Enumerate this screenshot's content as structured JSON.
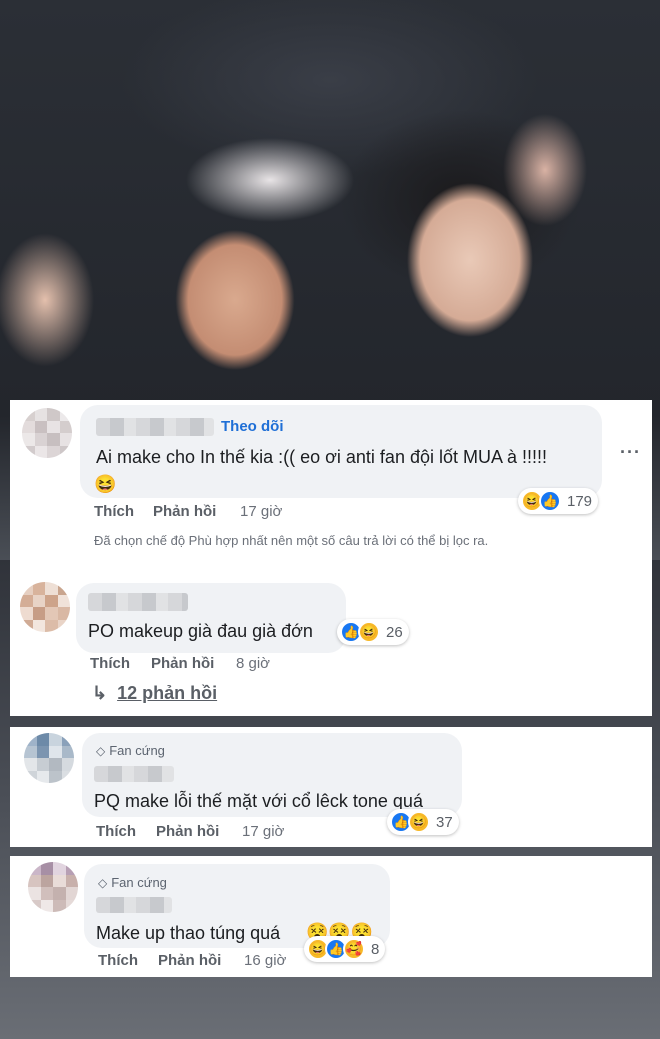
{
  "colors": {
    "link_blue": "#1f6fd6",
    "bubble_bg": "#f0f2f5",
    "secondary_text": "#5a5f66",
    "like_blue": "#1877f2",
    "haha_yellow": "#f7b928"
  },
  "comments": [
    {
      "follow_label": "Theo dõi",
      "text": "Ai make cho In thế kia :(( eo ơi anti fan đội lốt MUA à !!!!!",
      "trailing_emoji": "😆",
      "like_label": "Thích",
      "reply_label": "Phản hồi",
      "time": "17 giờ",
      "reaction_count": "179",
      "reactions": [
        "haha-icon",
        "like-icon"
      ],
      "filter_note": "Đã chọn chế độ Phù hợp nhất nên một số câu trả lời có thể bị lọc ra."
    },
    {
      "text": "PO makeup già đau già đớn",
      "like_label": "Thích",
      "reply_label": "Phản hồi",
      "time": "8 giờ",
      "reaction_count": "26",
      "reactions": [
        "like-icon",
        "haha-icon"
      ],
      "replies_label": "12 phản hồi"
    },
    {
      "badge": "Fan cứng",
      "text": "PQ make lỗi thế mặt với cổ lêck tone quá",
      "like_label": "Thích",
      "reply_label": "Phản hồi",
      "time": "17 giờ",
      "reaction_count": "37",
      "reactions": [
        "like-icon",
        "haha-icon"
      ]
    },
    {
      "badge": "Fan cứng",
      "text": "Make up thao túng quá",
      "inline_emojis": "😵😵😵",
      "like_label": "Thích",
      "reply_label": "Phản hồi",
      "time": "16 giờ",
      "reaction_count": "8",
      "reactions": [
        "haha-icon",
        "like-icon",
        "care-icon"
      ]
    }
  ]
}
